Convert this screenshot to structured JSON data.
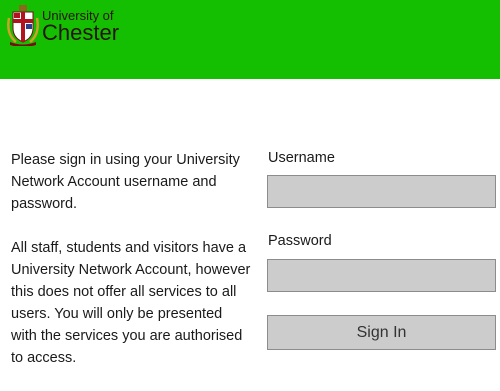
{
  "header": {
    "background_color": "#13bf00",
    "logo": {
      "line1": "University of",
      "line2": "Chester",
      "icon": "crest-icon"
    }
  },
  "intro": {
    "paragraph1": "Please sign in using your University Network Account username and password.",
    "paragraph2": "All staff, students and visitors have a University Network Account, however this does not offer all services to all users. You will only be presented with the services you are authorised to access."
  },
  "form": {
    "username_label": "Username",
    "username_value": "",
    "password_label": "Password",
    "password_value": "",
    "signin_label": "Sign In"
  }
}
